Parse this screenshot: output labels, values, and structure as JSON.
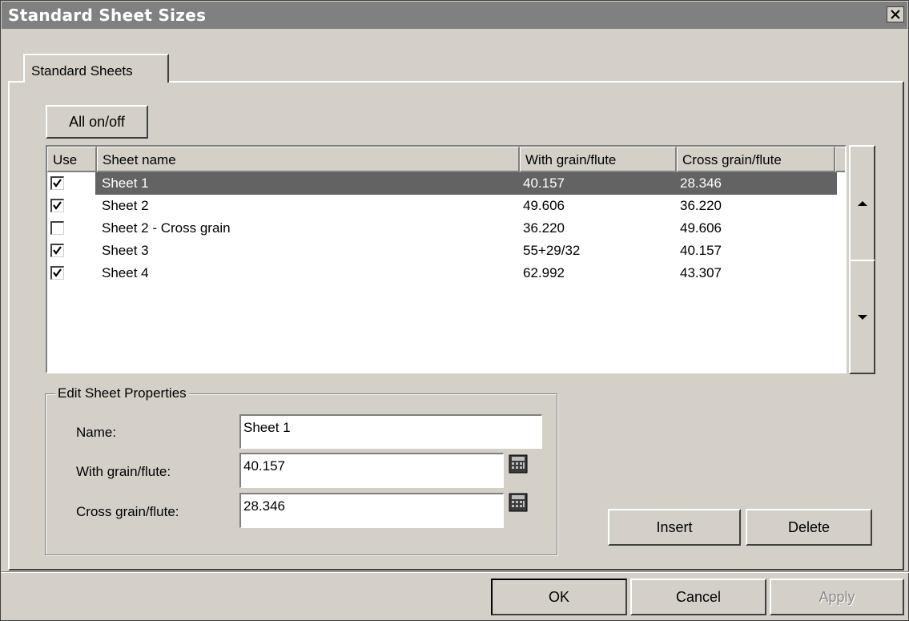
{
  "window": {
    "title": "Standard Sheet Sizes"
  },
  "tabs": [
    {
      "label": "Standard Sheets"
    }
  ],
  "toolbar": {
    "all_on_off_label": "All on/off"
  },
  "table": {
    "columns": [
      "Use",
      "Sheet name",
      "With grain/flute",
      "Cross grain/flute"
    ],
    "rows": [
      {
        "use": true,
        "name": "Sheet 1",
        "with_grain": "40.157",
        "cross_grain": "28.346",
        "selected": true
      },
      {
        "use": true,
        "name": "Sheet 2",
        "with_grain": "49.606",
        "cross_grain": "36.220",
        "selected": false
      },
      {
        "use": false,
        "name": "Sheet 2 - Cross grain",
        "with_grain": "36.220",
        "cross_grain": "49.606",
        "selected": false
      },
      {
        "use": true,
        "name": "Sheet 3",
        "with_grain": "55+29/32",
        "cross_grain": "40.157",
        "selected": false
      },
      {
        "use": true,
        "name": "Sheet 4",
        "with_grain": "62.992",
        "cross_grain": "43.307",
        "selected": false
      }
    ]
  },
  "edit_group": {
    "legend": "Edit Sheet Properties",
    "name_label": "Name:",
    "name_value": "Sheet 1",
    "with_grain_label": "With grain/flute:",
    "with_grain_value": "40.157",
    "cross_grain_label": "Cross grain/flute:",
    "cross_grain_value": "28.346"
  },
  "actions": {
    "insert_label": "Insert",
    "delete_label": "Delete"
  },
  "footer": {
    "ok_label": "OK",
    "cancel_label": "Cancel",
    "apply_label": "Apply",
    "apply_enabled": false
  },
  "icons": {
    "close": "close-icon",
    "scroll_up": "arrow-up-icon",
    "scroll_down": "arrow-down-icon",
    "calculator": "calculator-icon",
    "checkbox": "checkmark-icon"
  },
  "colors": {
    "titlebar": "#808080",
    "selection": "#636363",
    "face": "#d4d0c8"
  }
}
